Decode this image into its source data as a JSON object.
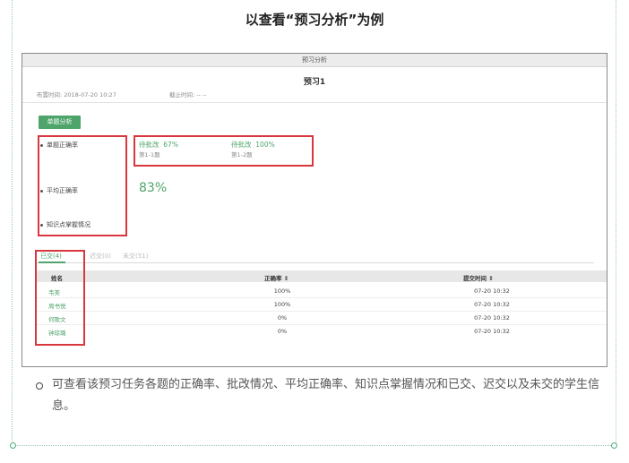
{
  "heading": "以查看“预习分析”为例",
  "panel": {
    "window_title": "预习分析",
    "task_title": "预习1",
    "publish_time": "布置时间: 2018-07-20 10:27",
    "deadline": "截止时间: -- --",
    "analysis_button": "单题分析",
    "metrics": [
      "单题正确率",
      "平均正确率",
      "知识点掌握情况"
    ],
    "questions": [
      {
        "status": "待批改",
        "rate": "67%",
        "label": "第1-1题"
      },
      {
        "status": "待批改",
        "rate": "100%",
        "label": "第1-2题"
      }
    ],
    "average_rate": "83%",
    "tabs": [
      {
        "label": "已交(4)",
        "active": true
      },
      {
        "label": "迟交(0)",
        "active": false
      },
      {
        "label": "未交(51)",
        "active": false
      }
    ],
    "table": {
      "columns": [
        "姓名",
        "正确率 ⇕",
        "提交时间 ⇕"
      ],
      "rows": [
        {
          "name": "韦美",
          "rate": "100%",
          "time": "07-20 10:32"
        },
        {
          "name": "周书悦",
          "rate": "100%",
          "time": "07-20 10:32"
        },
        {
          "name": "何歌文",
          "rate": "0%",
          "time": "07-20 10:32"
        },
        {
          "name": "钟琼璐",
          "rate": "0%",
          "time": "07-20 10:32"
        }
      ]
    }
  },
  "note": "可查看该预习任务各题的正确率、批改情况、平均正确率、知识点掌握情况和已交、迟交以及未交的学生信息。",
  "colors": {
    "accent": "#4ea46a",
    "highlight_box": "#d9363e",
    "frame": "#9fc7b0"
  }
}
